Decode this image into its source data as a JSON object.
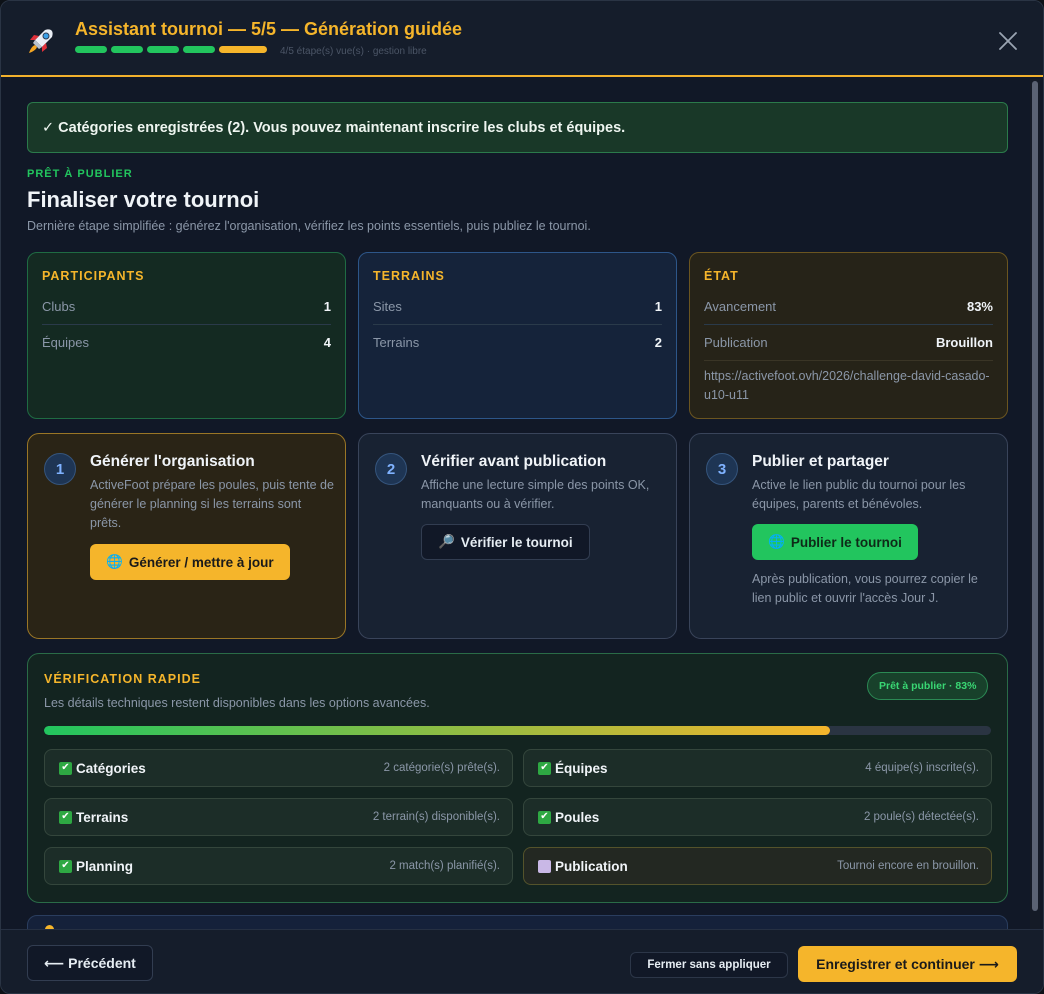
{
  "header": {
    "title": "Assistant tournoi — 5/5 — Génération guidée",
    "subtitle": "4/5 étape(s) vue(s) · gestion libre",
    "steps": [
      "done",
      "done",
      "done",
      "done",
      "current"
    ]
  },
  "alert": {
    "text": "✓ Catégories enregistrées (2). Vous pouvez maintenant inscrire les clubs et équipes."
  },
  "intro": {
    "eyebrow": "PRÊT À PUBLIER",
    "title": "Finaliser votre tournoi",
    "description": "Dernière étape simplifiée : générez l'organisation, vérifiez les points essentiels, puis publiez le tournoi."
  },
  "summary": {
    "participants": {
      "title": "PARTICIPANTS",
      "rows": [
        {
          "label": "Clubs",
          "value": "1"
        },
        {
          "label": "Équipes",
          "value": "4"
        }
      ]
    },
    "terrains": {
      "title": "TERRAINS",
      "rows": [
        {
          "label": "Sites",
          "value": "1"
        },
        {
          "label": "Terrains",
          "value": "2"
        }
      ]
    },
    "etat": {
      "title": "ÉTAT",
      "rows": [
        {
          "label": "Avancement",
          "value": "83%"
        },
        {
          "label": "Publication",
          "value": "Brouillon"
        }
      ],
      "url": "https://activefoot.ovh/2026/challenge-david-casado-u10-u11"
    }
  },
  "steps": [
    {
      "num": "1",
      "title": "Générer l'organisation",
      "description": "ActiveFoot prépare les poules, puis tente de générer le planning si les terrains sont prêts.",
      "button": "Générer / mettre à jour",
      "button_icon": "globe-icon"
    },
    {
      "num": "2",
      "title": "Vérifier avant publication",
      "description": "Affiche une lecture simple des points OK, manquants ou à vérifier.",
      "button": "Vérifier le tournoi",
      "button_icon": "magnifier-icon"
    },
    {
      "num": "3",
      "title": "Publier et partager",
      "description": "Active le lien public du tournoi pour les équipes, parents et bénévoles.",
      "button": "Publier le tournoi",
      "button_icon": "globe-icon",
      "note": "Après publication, vous pourrez copier le lien public et ouvrir l'accès Jour J."
    }
  ],
  "verification": {
    "title": "VÉRIFICATION RAPIDE",
    "description": "Les détails techniques restent disponibles dans les options avancées.",
    "badge": "Prêt à publier · 83%",
    "progress": 0.83,
    "items": [
      {
        "label": "Catégories",
        "detail": "2 catégorie(s) prête(s).",
        "status": "ok"
      },
      {
        "label": "Équipes",
        "detail": "4 équipe(s) inscrite(s).",
        "status": "ok"
      },
      {
        "label": "Terrains",
        "detail": "2 terrain(s) disponible(s).",
        "status": "ok"
      },
      {
        "label": "Poules",
        "detail": "2 poule(s) détectée(s).",
        "status": "ok"
      },
      {
        "label": "Planning",
        "detail": "2 match(s) planifié(s).",
        "status": "ok"
      },
      {
        "label": "Publication",
        "detail": "Tournoi encore en brouillon.",
        "status": "pending"
      }
    ]
  },
  "footer": {
    "prev": "⟵ Précédent",
    "close": "Fermer sans appliquer",
    "save": "Enregistrer et continuer ⟶"
  },
  "colors": {
    "accent": "#f5b52b",
    "success": "#22c55e",
    "background": "#111827"
  }
}
